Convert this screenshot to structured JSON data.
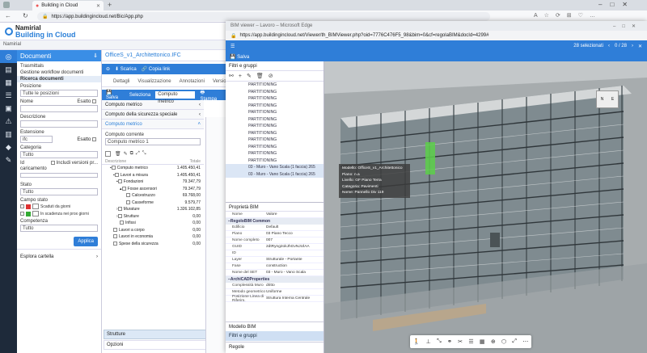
{
  "browser": {
    "tab_title": "Building in Cloud",
    "url": "https://app.buildingincloud.net/Bic/App.php"
  },
  "app": {
    "brand_top": "Namirial",
    "brand_bottom": "Building in Cloud",
    "breadcrumb": "Namirial"
  },
  "documents": {
    "title": "Documenti",
    "links": [
      "Trasmittals",
      "Gestione workflow documenti",
      "Ricerca documenti"
    ],
    "labels": {
      "posizione": "Posizione",
      "posizione_val": "Tutte le posizioni",
      "nome": "Nome",
      "esatto": "Esatto",
      "descrizione": "Descrizione",
      "estensione": "Estensione",
      "estensione_val": "ifc",
      "categoria": "Categoria",
      "categoria_val": "Tutto",
      "id": "Id",
      "includi": "Includi versioni pr...",
      "caricamento": "caricamento",
      "stato": "Stato",
      "stato_val": "Tutto",
      "campo_stato": "Campo stato",
      "scaduti": "Scaduti da giorni",
      "in_scadenza": "In scadenza nei prox giorni",
      "competenza": "Competenza",
      "competenza_val": "Tutto",
      "applica": "Applica",
      "esplora": "Esplora cartella"
    }
  },
  "middle": {
    "file_title": "OfficeS_v1_Architettonico.IFC",
    "scarica": "Scarica",
    "copia_link": "Copia link",
    "tabs": [
      "Dettagli",
      "Visualizzazione",
      "Annotazioni",
      "Versioni"
    ],
    "salva": "Salva",
    "seleziona": "Seleziona",
    "select_val": "Computo metrico",
    "stampa": "Stampa",
    "sections": [
      "Computo metrico",
      "Computo della sicurezza speciale",
      "Computo metrico"
    ],
    "computo_corrente": "Computo corrente",
    "computo_val": "Computo metrico 1",
    "tree_head": [
      "Descrizione",
      "Totale"
    ],
    "tree": [
      {
        "label": "Computo metrico",
        "value": "1.405.450,41"
      },
      {
        "label": "Lavori a misura",
        "value": "1.405.450,41"
      },
      {
        "label": "Fondazioni",
        "value": "79.347,79"
      },
      {
        "label": "Fosse ascensori",
        "value": "79.347,79"
      },
      {
        "label": "Calcestruzzo",
        "value": "69.768,00"
      },
      {
        "label": "Casseforme",
        "value": "9.579,77"
      },
      {
        "label": "Murature",
        "value": "1.326.102,85"
      },
      {
        "label": "Strutture",
        "value": "0,00"
      },
      {
        "label": "Infissi",
        "value": "0,00"
      },
      {
        "label": "Lavori a corpo",
        "value": "0,00"
      },
      {
        "label": "Lavori in economia",
        "value": "0,00"
      },
      {
        "label": "Spese della sicurezza",
        "value": "0,00"
      }
    ],
    "bottom": [
      "Strutture",
      "Opzioni"
    ]
  },
  "popup": {
    "window_title": "BIM viewer – Lavoro – Microsoft Edge",
    "url": "https://app.buildingincloud.net/Viewer/th_BIMViewer.php?oid=7776C476F5_98&bim=0&cf=regolaBIM&docId=4299#",
    "sel_text": "28 selezionati",
    "pager": "0 / 28",
    "salva": "Salva",
    "filter_title": "Filtri e gruppi",
    "parts": [
      "PARTITIONING",
      "PARTITIONING",
      "PARTITIONING",
      "PARTITIONING",
      "PARTITIONING",
      "PARTITIONING",
      "PARTITIONING",
      "PARTITIONING",
      "PARTITIONING",
      "PARTITIONING",
      "PARTITIONING",
      "PARTITIONING",
      "03 - Muro - Vano Scala (1 faccia) 265",
      "03 - Muro - Vano Scala (1 faccia) 265"
    ],
    "props_title": "Proprietà BIM",
    "props_head": [
      "Nome",
      "Valore"
    ],
    "group1": "RegoloBIM Common",
    "props1": [
      [
        "Edificio",
        "Default"
      ],
      [
        "Piano",
        "03 Piano Tecco"
      ],
      [
        "Nome completo",
        "007"
      ],
      [
        "GUID",
        "2dtRyng2okJhGvNJUlAA"
      ],
      [
        "ID",
        ""
      ],
      [
        "Layer",
        "Strutturale - Portante"
      ],
      [
        "Fase",
        "construction"
      ],
      [
        "Nome del SET",
        "03 - Muro - Vano Scala"
      ]
    ],
    "group2": "ArchiCADProperties",
    "props2": [
      [
        "Complessità Muro",
        "dritto"
      ],
      [
        "Metodo geometrico",
        "Uniforme"
      ],
      [
        "Posizione Linea di Riferim.",
        "Struttura Interna Centrale"
      ]
    ],
    "bottom_tabs": [
      "Modello BIM",
      "Filtri e gruppi",
      "Regole"
    ],
    "tooltip": [
      [
        "Modello:",
        "OfficeS_v1_Architettonico"
      ],
      [
        "Piano:",
        "n.a"
      ],
      [
        "Livello:",
        "GF Piano Terra"
      ],
      [
        "Categoria:",
        "Pavimenti"
      ],
      [
        "Nome:",
        "Pannello Div 119"
      ]
    ]
  }
}
